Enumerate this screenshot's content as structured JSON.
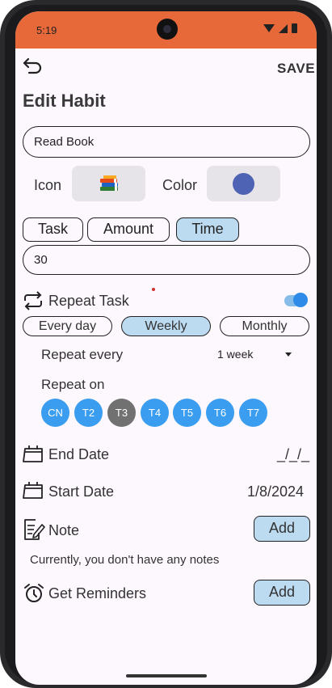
{
  "status": {
    "time": "5:19"
  },
  "toolbar": {
    "save_label": "SAVE"
  },
  "page": {
    "title": "Edit Habit"
  },
  "habit": {
    "name": "Read Book"
  },
  "icon_row": {
    "icon_label": "Icon",
    "color_label": "Color",
    "icon": "books-icon",
    "color_value": "#4e63b4"
  },
  "goal_type": {
    "options": [
      "Task",
      "Amount",
      "Time"
    ],
    "selected": "Time",
    "value": "30"
  },
  "repeat": {
    "label": "Repeat Task",
    "enabled": true,
    "frequencies": [
      "Every day",
      "Weekly",
      "Monthly"
    ],
    "selected_frequency": "Weekly",
    "every_label": "Repeat every",
    "every_value": "1 week",
    "on_label": "Repeat on",
    "days": [
      {
        "label": "CN",
        "selected": true
      },
      {
        "label": "T2",
        "selected": true
      },
      {
        "label": "T3",
        "selected": false
      },
      {
        "label": "T4",
        "selected": true
      },
      {
        "label": "T5",
        "selected": true
      },
      {
        "label": "T6",
        "selected": true
      },
      {
        "label": "T7",
        "selected": true
      }
    ]
  },
  "end_date": {
    "label": "End Date",
    "value": "_/_/_"
  },
  "start_date": {
    "label": "Start Date",
    "value": "1/8/2024"
  },
  "note": {
    "label": "Note",
    "button": "Add",
    "empty_text": "Currently, you don't have any notes"
  },
  "reminders": {
    "label": "Get Reminders",
    "button": "Add"
  },
  "colors": {
    "statusbar": "#e7693a",
    "accent": "#3a9df0",
    "selected_fill": "#bcdaf0"
  }
}
